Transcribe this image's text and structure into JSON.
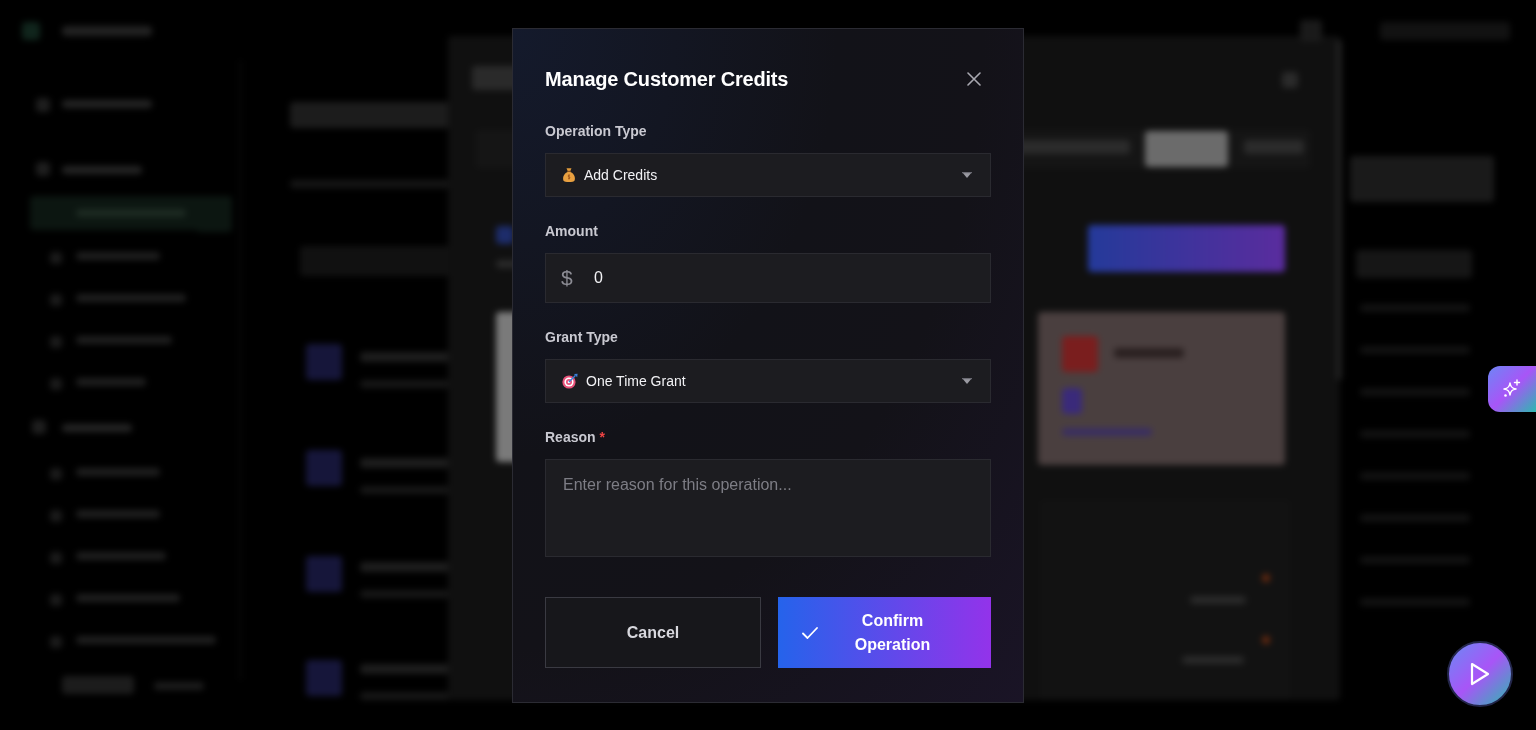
{
  "dialog": {
    "title": "Manage Customer Credits",
    "fields": [
      {
        "kind": "select",
        "label": "Operation Type",
        "value": "Add Credits"
      },
      {
        "kind": "currency",
        "label": "Amount",
        "prefix": "$",
        "value": "0"
      },
      {
        "kind": "select",
        "label": "Grant Type",
        "value": "One Time Grant"
      },
      {
        "kind": "textarea",
        "label": "Reason",
        "required_mark": "*",
        "placeholder": "Enter reason for this operation..."
      }
    ],
    "buttons": [
      {
        "kind": "secondary",
        "label": "Cancel"
      },
      {
        "kind": "primary",
        "label": "Confirm Operation"
      }
    ]
  }
}
